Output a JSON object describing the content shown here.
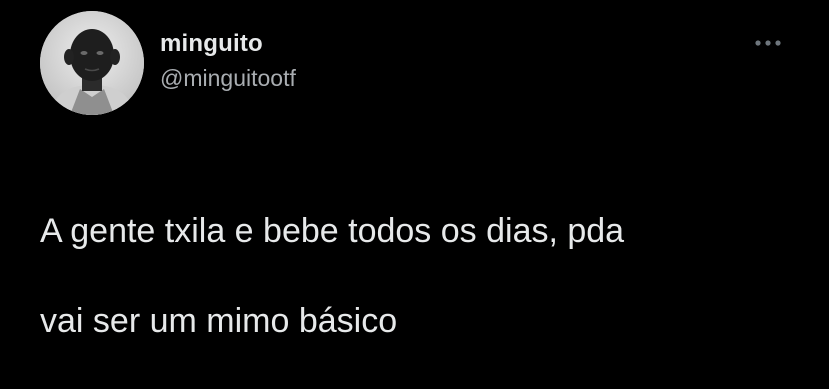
{
  "tweet": {
    "author": {
      "display_name": "minguito",
      "handle": "@minguitootf",
      "avatar_icon": "profile-photo"
    },
    "more_icon": "more-options-icon",
    "text_line1": "A gente txila e bebe todos os dias, pda",
    "text_line2": "vai ser um mimo básico"
  },
  "colors": {
    "background": "#000000",
    "primary_text": "#e7e9ea",
    "secondary_text": "#a9adb1"
  }
}
